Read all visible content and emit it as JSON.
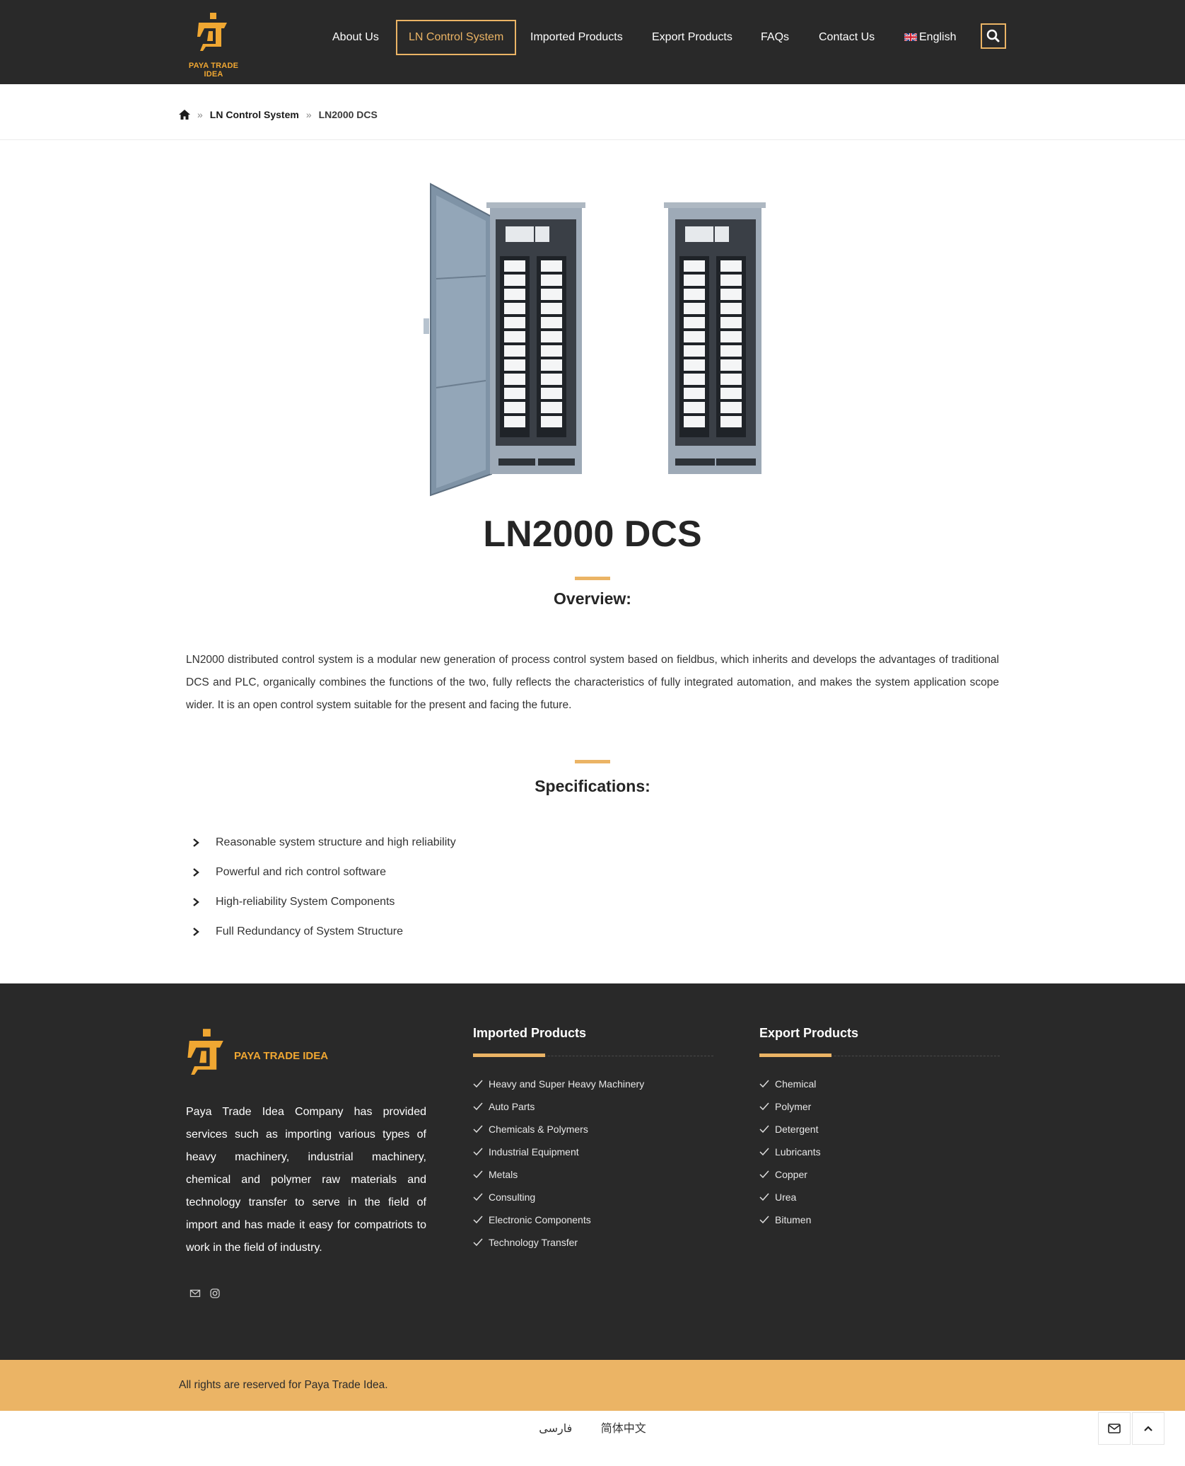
{
  "header": {
    "logo_text": "PAYA TRADE IDEA",
    "nav": [
      {
        "label": "About Us"
      },
      {
        "label": "LN Control System"
      },
      {
        "label": "Imported Products"
      },
      {
        "label": "Export Products"
      },
      {
        "label": "FAQs"
      },
      {
        "label": "Contact Us"
      },
      {
        "label": "English"
      }
    ],
    "active_nav": "LN Control System"
  },
  "breadcrumb": {
    "parent": "LN Control System",
    "current": "LN2000 DCS"
  },
  "product": {
    "title": "LN2000 DCS",
    "overview_heading": "Overview:",
    "overview_text": "LN2000 distributed control system is a modular new generation of process control system based on fieldbus, which inherits and develops the advantages of traditional DCS and PLC, organically combines the functions of the two, fully reflects the characteristics of fully integrated automation, and makes the system application scope wider. It is an open control system suitable for the present and facing the future.",
    "spec_heading": "Specifications:",
    "specs": [
      "Reasonable system structure and high reliability",
      "Powerful and rich control software",
      "High-reliability System Components",
      "Full Redundancy of System Structure"
    ]
  },
  "footer": {
    "logo_text": "PAYA TRADE IDEA",
    "about": "Paya Trade Idea Company has provided services such as importing various types of heavy machinery, industrial machinery, chemical and polymer raw materials and technology transfer to serve in the field of import and has made it easy for compatriots to work in the field of industry.",
    "imported_title": "Imported Products",
    "imported": [
      "Heavy and Super Heavy Machinery",
      "Auto Parts",
      "Chemicals & Polymers",
      "Industrial Equipment",
      "Metals",
      "Consulting",
      "Electronic Components",
      "Technology Transfer"
    ],
    "export_title": "Export Products",
    "export": [
      "Chemical",
      "Polymer",
      "Detergent",
      "Lubricants",
      "Copper",
      "Urea",
      "Bitumen"
    ],
    "copyright": "All rights are reserved for Paya Trade Idea."
  },
  "languages": [
    "فارسی",
    "简体中文"
  ],
  "icons": {
    "home": "home-icon",
    "search": "search-icon",
    "chevron": "chevron-right-icon",
    "check": "check-icon",
    "mail": "mail-icon",
    "instagram": "instagram-icon",
    "scroll_top": "chevron-up-icon"
  },
  "colors": {
    "brand_dark": "#292929",
    "accent": "#ebb465",
    "logo_orange": "#f0a732"
  }
}
